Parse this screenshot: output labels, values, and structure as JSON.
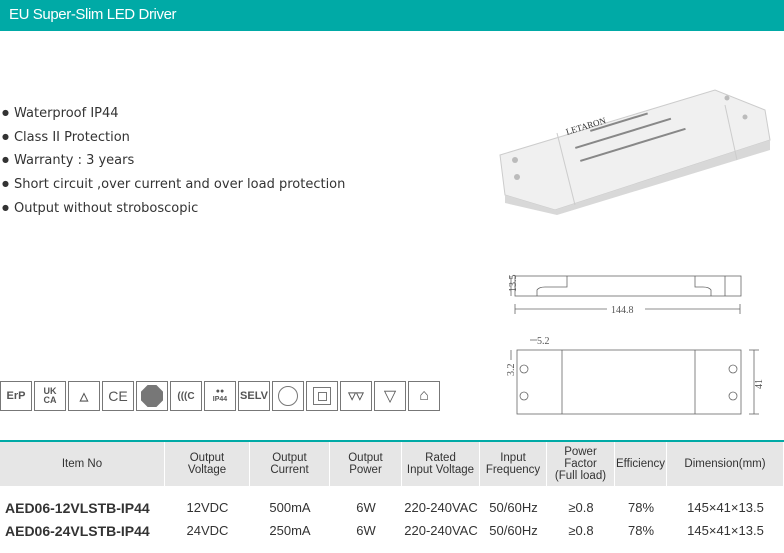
{
  "header": {
    "title": "EU Super-Slim LED Driver"
  },
  "features": [
    "Waterproof IP44",
    "Class II Protection",
    "Warranty : 3 years",
    "Short circuit ,over current and over load protection",
    "Output without stroboscopic"
  ],
  "product_image": {
    "brand": "LETARON"
  },
  "drawing": {
    "height": "13.5",
    "length": "144.8",
    "offset_x": "5.2",
    "offset_y": "3.2",
    "width": "41"
  },
  "certifications": [
    {
      "icon": "erp-icon",
      "label": "ErP"
    },
    {
      "icon": "ukca-icon",
      "label": "UK CA"
    },
    {
      "icon": "rcm-icon",
      "label": ""
    },
    {
      "icon": "ce-icon",
      "label": "CE"
    },
    {
      "icon": "tuv-icon",
      "label": ""
    },
    {
      "icon": "ccc-icon",
      "label": ""
    },
    {
      "icon": "ip44-icon",
      "label": "IP44"
    },
    {
      "icon": "selv-icon",
      "label": "SELV"
    },
    {
      "icon": "independent-icon",
      "label": ""
    },
    {
      "icon": "class-ii-icon",
      "label": ""
    },
    {
      "icon": "mm-icon",
      "label": ""
    },
    {
      "icon": "temperature-icon",
      "label": ""
    },
    {
      "icon": "house-icon",
      "label": ""
    }
  ],
  "table": {
    "headers": [
      "Item No",
      "Output\nVoltage",
      "Output\nCurrent",
      "Output\nPower",
      "Rated\nInput Voltage",
      "Input\nFrequency",
      "Power Factor\n(Full load)",
      "Efficiency",
      "Dimension(mm)"
    ],
    "rows": [
      [
        "AED06-12VLSTB-IP44",
        "12VDC",
        "500mA",
        "6W",
        "220-240VAC",
        "50/60Hz",
        "≥0.8",
        "78%",
        "145×41×13.5"
      ],
      [
        "AED06-24VLSTB-IP44",
        "24VDC",
        "250mA",
        "6W",
        "220-240VAC",
        "50/60Hz",
        "≥0.8",
        "78%",
        "145×41×13.5"
      ]
    ]
  },
  "colors": {
    "accent": "#00aaa6",
    "header_bg": "#e6e6e6"
  }
}
